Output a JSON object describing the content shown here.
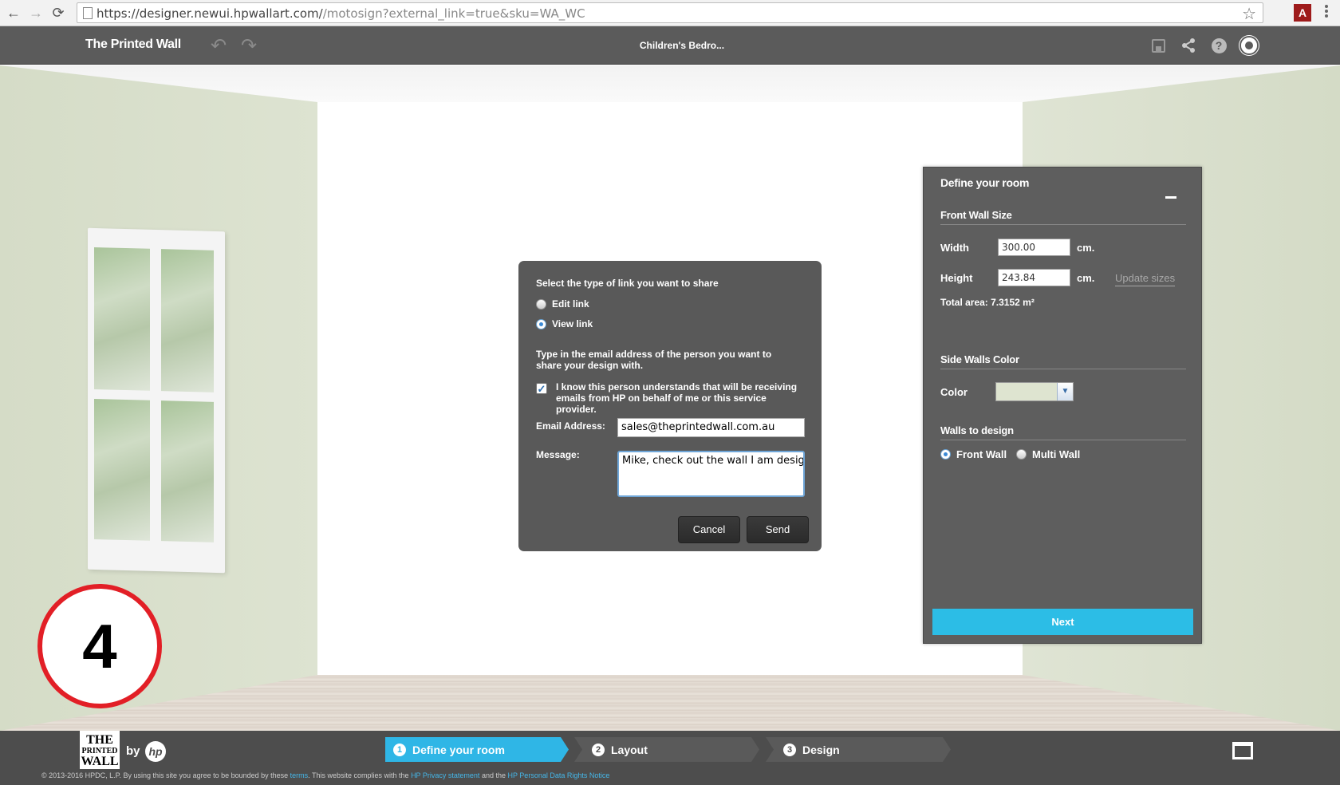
{
  "browser": {
    "url_main": "https://designer.newui.hpwallart.com/",
    "url_rest": "/motosign?external_link=true&sku=WA_WC",
    "back_icon": "←",
    "forward_icon": "→",
    "reload_icon": "⟳",
    "star_icon": "☆",
    "pdf_icon": "A"
  },
  "header": {
    "brand": "The Printed Wall",
    "design_name": "Children's Bedro...",
    "undo_icon": "↶",
    "redo_icon": "↷",
    "share_icon": "<",
    "help_icon": "?"
  },
  "room": {
    "step_badge": "4",
    "colors": {
      "side_walls": "#d7decb",
      "front_wall": "#ffffff"
    }
  },
  "share_modal": {
    "heading": "Select the type of link you want to share",
    "options": [
      {
        "label": "Edit link",
        "checked": false
      },
      {
        "label": "View link",
        "checked": true
      }
    ],
    "instructions": "Type in the email address of the person you want to share your design with.",
    "consent_text": "I know this person understands that will be receiving emails from HP on behalf of me or this service provider.",
    "consent_checked": "✓",
    "email_label": "Email Address:",
    "email_value": "sales@theprintedwall.com.au",
    "message_label": "Message:",
    "message_value": "Mike, check out the wall I am designing.",
    "cancel_label": "Cancel",
    "send_label": "Send"
  },
  "side_panel": {
    "title": "Define your room",
    "front_wall_title": "Front Wall Size",
    "width_label": "Width",
    "width_value": "300.00",
    "height_label": "Height",
    "height_value": "243.84",
    "unit": "cm.",
    "update_sizes": "Update sizes",
    "total_area": "Total area: 7.3152 m²",
    "side_walls_title": "Side Walls Color",
    "color_label": "Color",
    "color_value": "#dee4d0",
    "walls_to_design_title": "Walls to design",
    "wall_options": [
      {
        "label": "Front Wall",
        "checked": true
      },
      {
        "label": "Multi Wall",
        "checked": false
      }
    ],
    "next_label": "Next",
    "accent_color": "#2cbde6"
  },
  "footer": {
    "logo_line1": "THE",
    "logo_line2": "PRINTED",
    "logo_line3": "WALL",
    "by": "by",
    "hp": "hp",
    "steps": [
      {
        "num": "1",
        "label": "Define your room",
        "active": true
      },
      {
        "num": "2",
        "label": "Layout",
        "active": false
      },
      {
        "num": "3",
        "label": "Design",
        "active": false
      }
    ],
    "copyright_pre": "© 2013-2016 HPDC, L.P.  By using this site you agree to be bounded by these ",
    "terms": "terms",
    "copyright_mid": ". This website complies with the ",
    "privacy": "HP Privacy statement",
    "and": " and the ",
    "rights": "HP Personal Data Rights Notice"
  }
}
